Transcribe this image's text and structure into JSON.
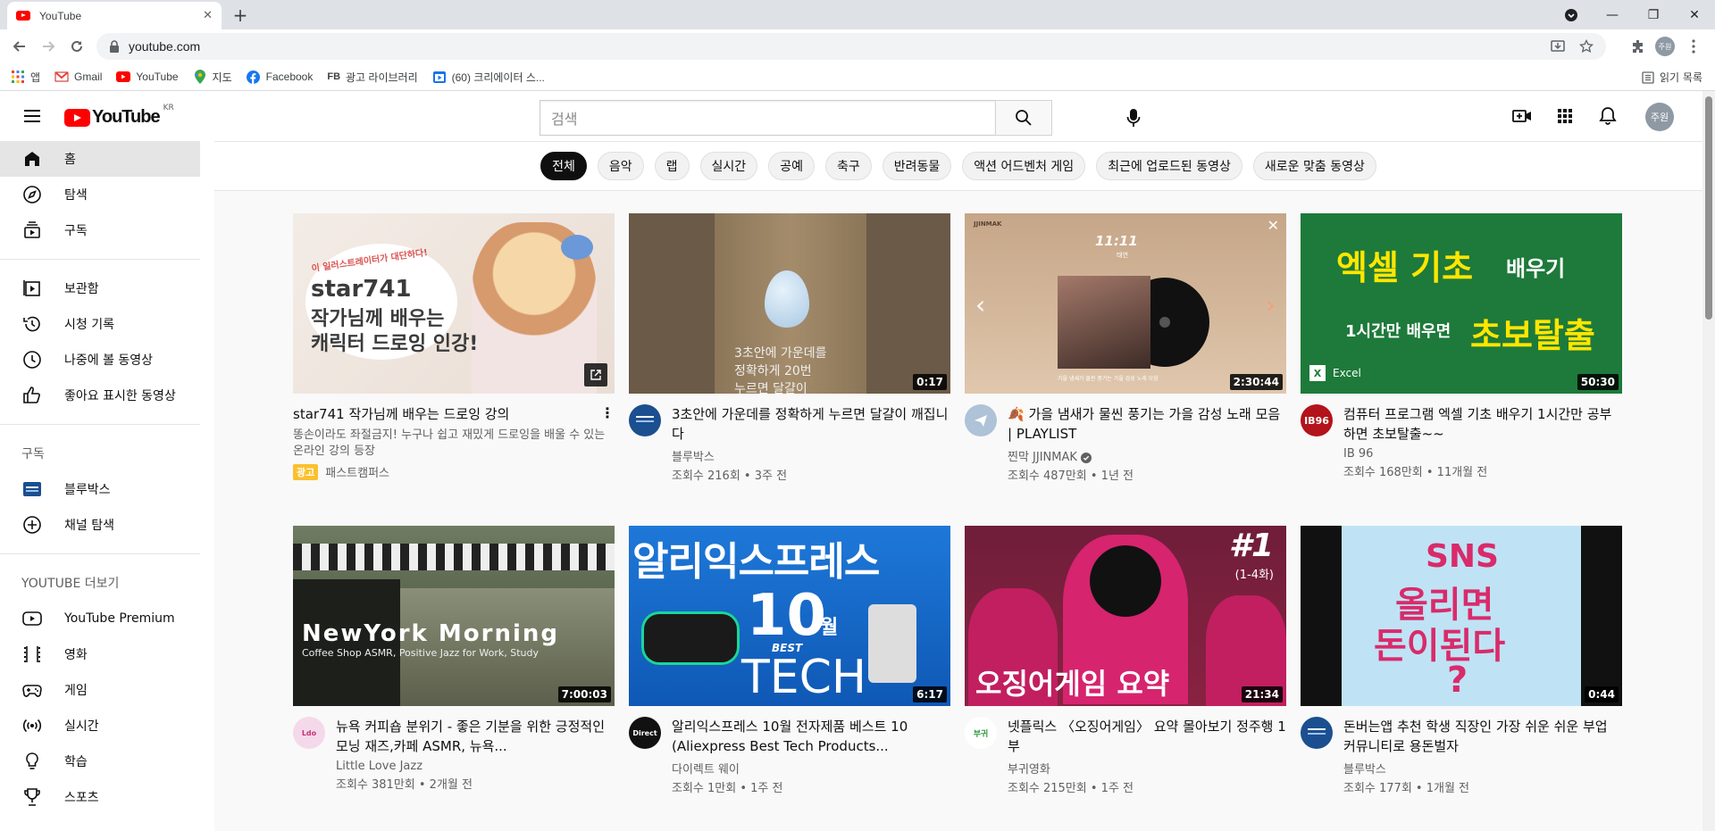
{
  "browser": {
    "tab_title": "YouTube",
    "url": "youtube.com",
    "profile_initial": "주원",
    "bookmarks": [
      {
        "label": "앱",
        "icon": "apps-grid-icon"
      },
      {
        "label": "Gmail",
        "icon": "gmail-icon"
      },
      {
        "label": "YouTube",
        "icon": "youtube-icon"
      },
      {
        "label": "지도",
        "icon": "maps-icon"
      },
      {
        "label": "Facebook",
        "icon": "facebook-icon"
      },
      {
        "label": "광고 라이브러리",
        "icon": "fb-icon"
      },
      {
        "label": "(60) 크리에이터 스...",
        "icon": "studio-icon"
      }
    ],
    "reading_list": "읽기 목록"
  },
  "masthead": {
    "logo_text": "YouTube",
    "country_code": "KR",
    "search_placeholder": "검색",
    "avatar_text": "주원"
  },
  "sidebar": {
    "main": [
      {
        "label": "홈",
        "icon": "home-icon",
        "active": true
      },
      {
        "label": "탐색",
        "icon": "explore-icon"
      },
      {
        "label": "구독",
        "icon": "subscriptions-icon"
      }
    ],
    "library": [
      {
        "label": "보관함",
        "icon": "library-icon"
      },
      {
        "label": "시청 기록",
        "icon": "history-icon"
      },
      {
        "label": "나중에 볼 동영상",
        "icon": "watch-later-icon"
      },
      {
        "label": "좋아요 표시한 동영상",
        "icon": "thumbs-up-icon"
      }
    ],
    "subs_heading": "구독",
    "subs": [
      {
        "label": "블루박스",
        "icon": "channel-avatar"
      },
      {
        "label": "채널 탐색",
        "icon": "add-circle-icon"
      }
    ],
    "more_heading": "YOUTUBE 더보기",
    "more": [
      {
        "label": "YouTube Premium",
        "icon": "premium-icon"
      },
      {
        "label": "영화",
        "icon": "film-icon"
      },
      {
        "label": "게임",
        "icon": "gamepad-icon"
      },
      {
        "label": "실시간",
        "icon": "live-icon"
      },
      {
        "label": "학습",
        "icon": "bulb-icon"
      },
      {
        "label": "스포츠",
        "icon": "trophy-icon"
      }
    ]
  },
  "chips": [
    "전체",
    "음악",
    "랩",
    "실시간",
    "공예",
    "축구",
    "반려동물",
    "액션 어드벤처 게임",
    "최근에 업로드된 동영상",
    "새로운 맞춤 동영상"
  ],
  "videos": [
    {
      "title": "star741 작가님께 배우는 드로잉 강의",
      "channel": "패스트캠퍼스",
      "stats": "",
      "duration": "",
      "ad": true,
      "ad_desc": "똥손이라도 좌절금지! 누구나 쉽고 재밌게 드로잉을 배울 수 있는 온라인 강의 등장",
      "ad_badge": "광고",
      "thumb_text": [
        "이 일러스트레이터가 대단하다!",
        "star741",
        "작가님께 배우는",
        "캐릭터 드로잉 인강!"
      ]
    },
    {
      "title": "3초안에 가운데를 정확하게 누르면 달걀이 깨집니다",
      "channel": "블루박스",
      "stats": "조회수 216회 • 3주 전",
      "duration": "0:17",
      "thumb_text": [
        "3초안에 가운데를",
        "정확하게 20번",
        "누르면 달걀이"
      ]
    },
    {
      "title": "🍂 가을 냄새가 물씬 풍기는 가을 감성 노래 모음 | PLAYLIST",
      "channel": "찐막 JJINMAK",
      "stats": "조회수 487만회 • 1년 전",
      "duration": "2:30:44",
      "verified": true,
      "thumb_text": [
        "JJINMAK",
        "11:11",
        "태연",
        "가을 냄새가 물씬 풍기는 가을 감성 노래 모음"
      ]
    },
    {
      "title": "컴퓨터 프로그램 엑셀 기초 배우기 1시간만 공부하면 초보탈출~~",
      "channel": "IB 96",
      "stats": "조회수 168만회 • 11개월 전",
      "duration": "50:30",
      "thumb_text": [
        "엑셀 기초",
        "배우기",
        "1시간만 배우면",
        "초보탈출",
        "Excel"
      ]
    },
    {
      "title": "뉴욕 커피숍 분위기 - 좋은 기분을 위한 긍정적인 모닝 재즈,카페 ASMR, 뉴욕...",
      "channel": "Little Love Jazz",
      "stats": "조회수 381만회 • 2개월 전",
      "duration": "7:00:03",
      "thumb_text": [
        "NewYork Morning",
        "Coffee Shop ASMR, Positive Jazz for Work, Study"
      ]
    },
    {
      "title": "알리익스프레스 10월 전자제품 베스트 10 (Aliexpress Best Tech Products...",
      "channel": "다이렉트 웨이",
      "stats": "조회수 1만회 • 1주 전",
      "duration": "6:17",
      "thumb_text": [
        "알리익스프레스",
        "10",
        "월",
        "BEST",
        "TECH"
      ]
    },
    {
      "title": "넷플릭스 〈오징어게임〉 요약 몰아보기 정주행 1부",
      "channel": "부귀영화",
      "stats": "조회수 215만회 • 1주 전",
      "duration": "21:34",
      "thumb_text": [
        "#1",
        "(1-4화)",
        "오징어게임 요약"
      ]
    },
    {
      "title": "돈버는앱 추천 학생 직장인 가장 쉬운 쉬운 부업 커뮤니티로 용돈벌자",
      "channel": "블루박스",
      "stats": "조회수 177회 • 1개월 전",
      "duration": "0:44",
      "thumb_text": [
        "SNS",
        "올리면",
        "돈이된다",
        "?"
      ]
    }
  ],
  "colors": {
    "yt_red": "#ff0000",
    "chip_active": "#0f0f0f",
    "ad_badge": "#fbc02d"
  }
}
